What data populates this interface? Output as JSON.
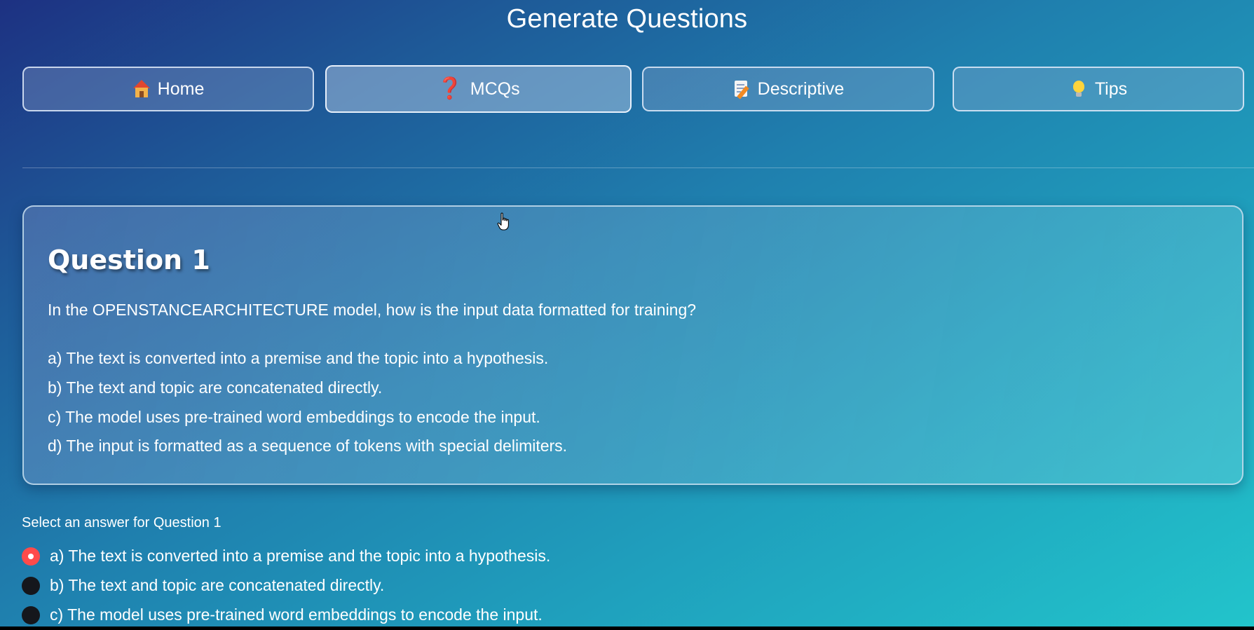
{
  "page": {
    "title": "Generate Questions"
  },
  "nav": {
    "home": {
      "icon": "home-icon",
      "label": "Home"
    },
    "mcqs": {
      "icon": "question-mark-icon",
      "glyph": "❓",
      "label": "MCQs"
    },
    "descriptive": {
      "icon": "memo-icon",
      "label": "Descriptive"
    },
    "tips": {
      "icon": "light-bulb-icon",
      "label": "Tips"
    }
  },
  "question": {
    "heading": "Question 1",
    "text": "In the OPENSTANCEARCHITECTURE model, how is the input data formatted for training?",
    "options": [
      "a) The text is converted into a premise and the topic into a hypothesis.",
      "b) The text and topic are concatenated directly.",
      "c) The model uses pre-trained word embeddings to encode the input.",
      "d) The input is formatted as a sequence of tokens with special delimiters."
    ]
  },
  "answer": {
    "label": "Select an answer for Question 1",
    "selected_index": 0,
    "choices": [
      "a) The text is converted into a premise and the topic into a hypothesis.",
      "b) The text and topic are concatenated directly.",
      "c) The model uses pre-trained word embeddings to encode the input."
    ]
  },
  "colors": {
    "radio_selected": "#ff4b4b",
    "radio_unselected": "#15171c",
    "gradient_start": "#1d3182",
    "gradient_end": "#22c4cb"
  }
}
